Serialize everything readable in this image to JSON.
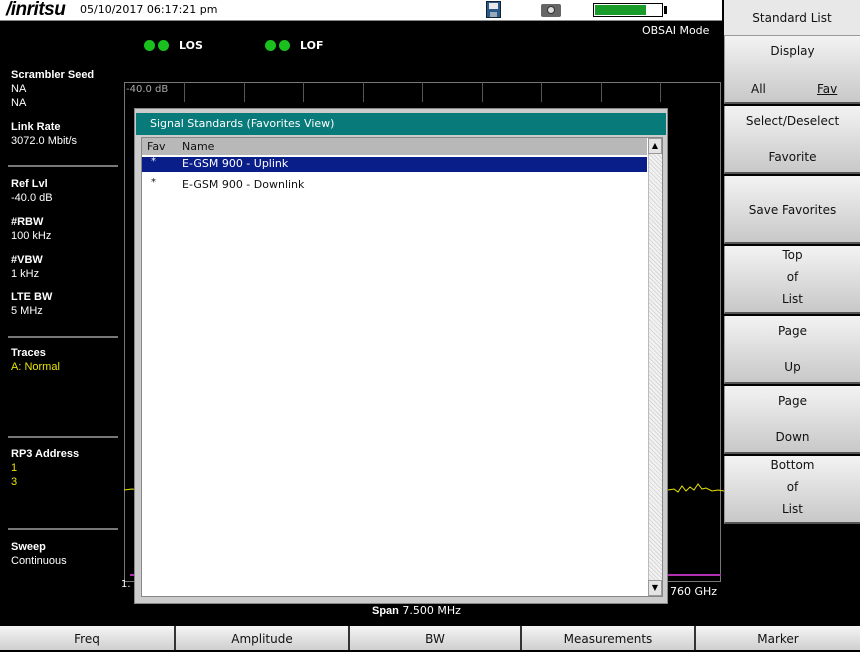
{
  "title_bar": {
    "brand": "/inritsu",
    "datetime": "05/10/2017 06:17:21 pm",
    "battery_level": 0.78
  },
  "status": {
    "los": "LOS",
    "lof": "LOF",
    "mode": "OBSAI Mode",
    "led_color": "#19c01e"
  },
  "left_panel": {
    "scrambler_seed_label": "Scrambler Seed",
    "scrambler_seed_values": [
      "NA",
      "NA"
    ],
    "link_rate_label": "Link Rate",
    "link_rate_value": "3072.0 Mbit/s",
    "ref_lvl_label": "Ref Lvl",
    "ref_lvl_value": "-40.0 dB",
    "rbw_label": "#RBW",
    "rbw_value": "100 kHz",
    "vbw_label": "#VBW",
    "vbw_value": "1 kHz",
    "lte_bw_label": "LTE BW",
    "lte_bw_value": "5 MHz",
    "traces_label": "Traces",
    "traces_value": "A: Normal",
    "rp3_label": "RP3 Address",
    "rp3_values": [
      "1",
      "3"
    ],
    "sweep_label": "Sweep",
    "sweep_value": "Continuous"
  },
  "graph": {
    "ref_label": "-40.0 dB",
    "start_fragment": "1.",
    "stop_fragment": "760 GHz",
    "span_label": "Span",
    "span_value": "7.500 MHz"
  },
  "dialog": {
    "title": "Signal Standards (Favorites View)",
    "col_fav": "Fav",
    "col_name": "Name",
    "rows": [
      {
        "fav": "*",
        "name": "E-GSM 900 - Uplink",
        "selected": true
      },
      {
        "fav": "*",
        "name": "E-GSM 900 - Downlink",
        "selected": false
      }
    ],
    "scroll_up": "▲",
    "scroll_down": "▼",
    "selection_color": "#0a1e8a",
    "title_color": "#087a7a"
  },
  "softkeys": {
    "title": "Standard List",
    "display_label": "Display",
    "display_all": "All",
    "display_fav": "Fav",
    "select_line1": "Select/Deselect",
    "select_line2": "Favorite",
    "save_favorites": "Save Favorites",
    "top_l1": "Top",
    "top_l2": "of",
    "top_l3": "List",
    "page_up_l1": "Page",
    "page_up_l2": "Up",
    "page_down_l1": "Page",
    "page_down_l2": "Down",
    "bottom_l1": "Bottom",
    "bottom_l2": "of",
    "bottom_l3": "List"
  },
  "tabs": [
    "Freq",
    "Amplitude",
    "BW",
    "Measurements",
    "Marker"
  ]
}
